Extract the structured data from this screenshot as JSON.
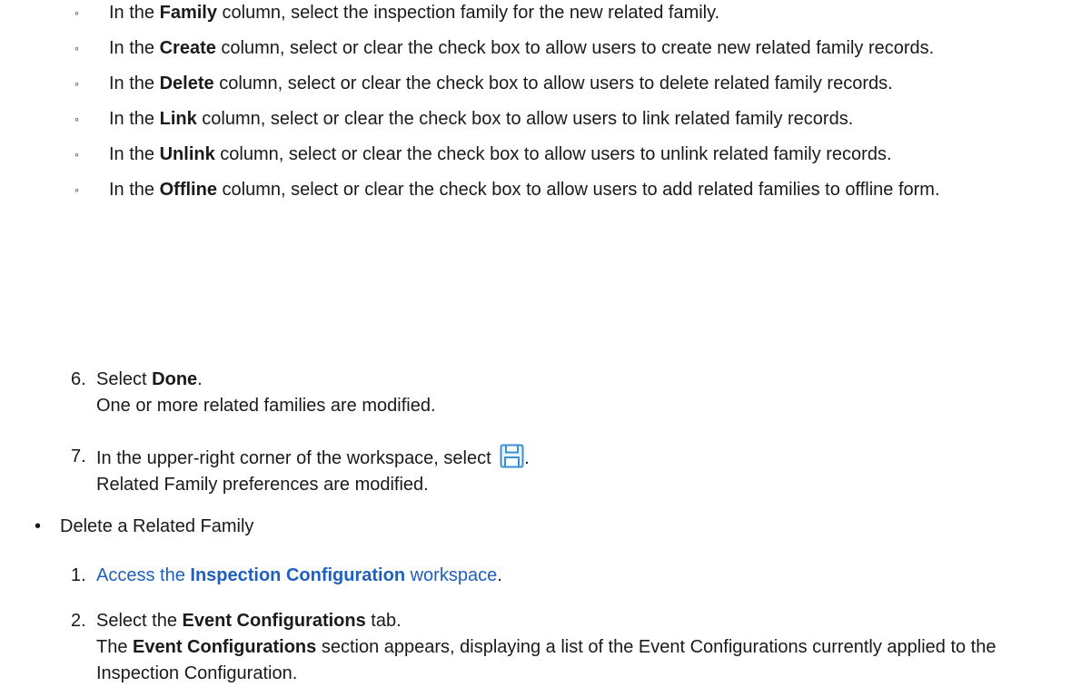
{
  "sub_items": [
    {
      "pre": "In the ",
      "bold": "Family",
      "post": " column, select the inspection family for the new related family."
    },
    {
      "pre": "In the ",
      "bold": "Create",
      "post": " column, select or clear the check box to allow users to create new related family records."
    },
    {
      "pre": "In the ",
      "bold": "Delete",
      "post": " column, select or clear the check box to allow users to delete related family records."
    },
    {
      "pre": "In the ",
      "bold": "Link",
      "post": " column, select or clear the check box to allow users to link related family records."
    },
    {
      "pre": "In the ",
      "bold": "Unlink",
      "post": " column, select or clear the check box to allow users to unlink related family records."
    },
    {
      "pre": "In the ",
      "bold": "Offline",
      "post": " column, select or clear the check box to allow users to add related families to offline form."
    }
  ],
  "step6": {
    "num": "6.",
    "pre": "Select ",
    "bold": "Done",
    "post": ".",
    "result": "One or more related families are modified."
  },
  "step7": {
    "num": "7.",
    "pre": "In the upper-right corner of the workspace, select ",
    "post": ".",
    "result": "Related Family preferences are modified."
  },
  "section_bullet": "Delete a Related Family",
  "delete_step1": {
    "num": "1.",
    "link_pre": "Access the ",
    "link_bold": "Inspection Configuration",
    "link_post": " workspace",
    "post": "."
  },
  "delete_step2": {
    "num": "2.",
    "pre": "Select the ",
    "bold": "Event Configurations",
    "post": " tab.",
    "result_pre": "The ",
    "result_bold": "Event Configurations",
    "result_post": " section appears, displaying a list of the Event Configurations currently applied to the Inspection Configuration."
  },
  "colors": {
    "link": "#1f5fbf",
    "icon": "#3a8fd6"
  },
  "icons": {
    "save": "save-icon",
    "sub_bullet": "hollow-circle",
    "bullet": "bullet-dot"
  }
}
